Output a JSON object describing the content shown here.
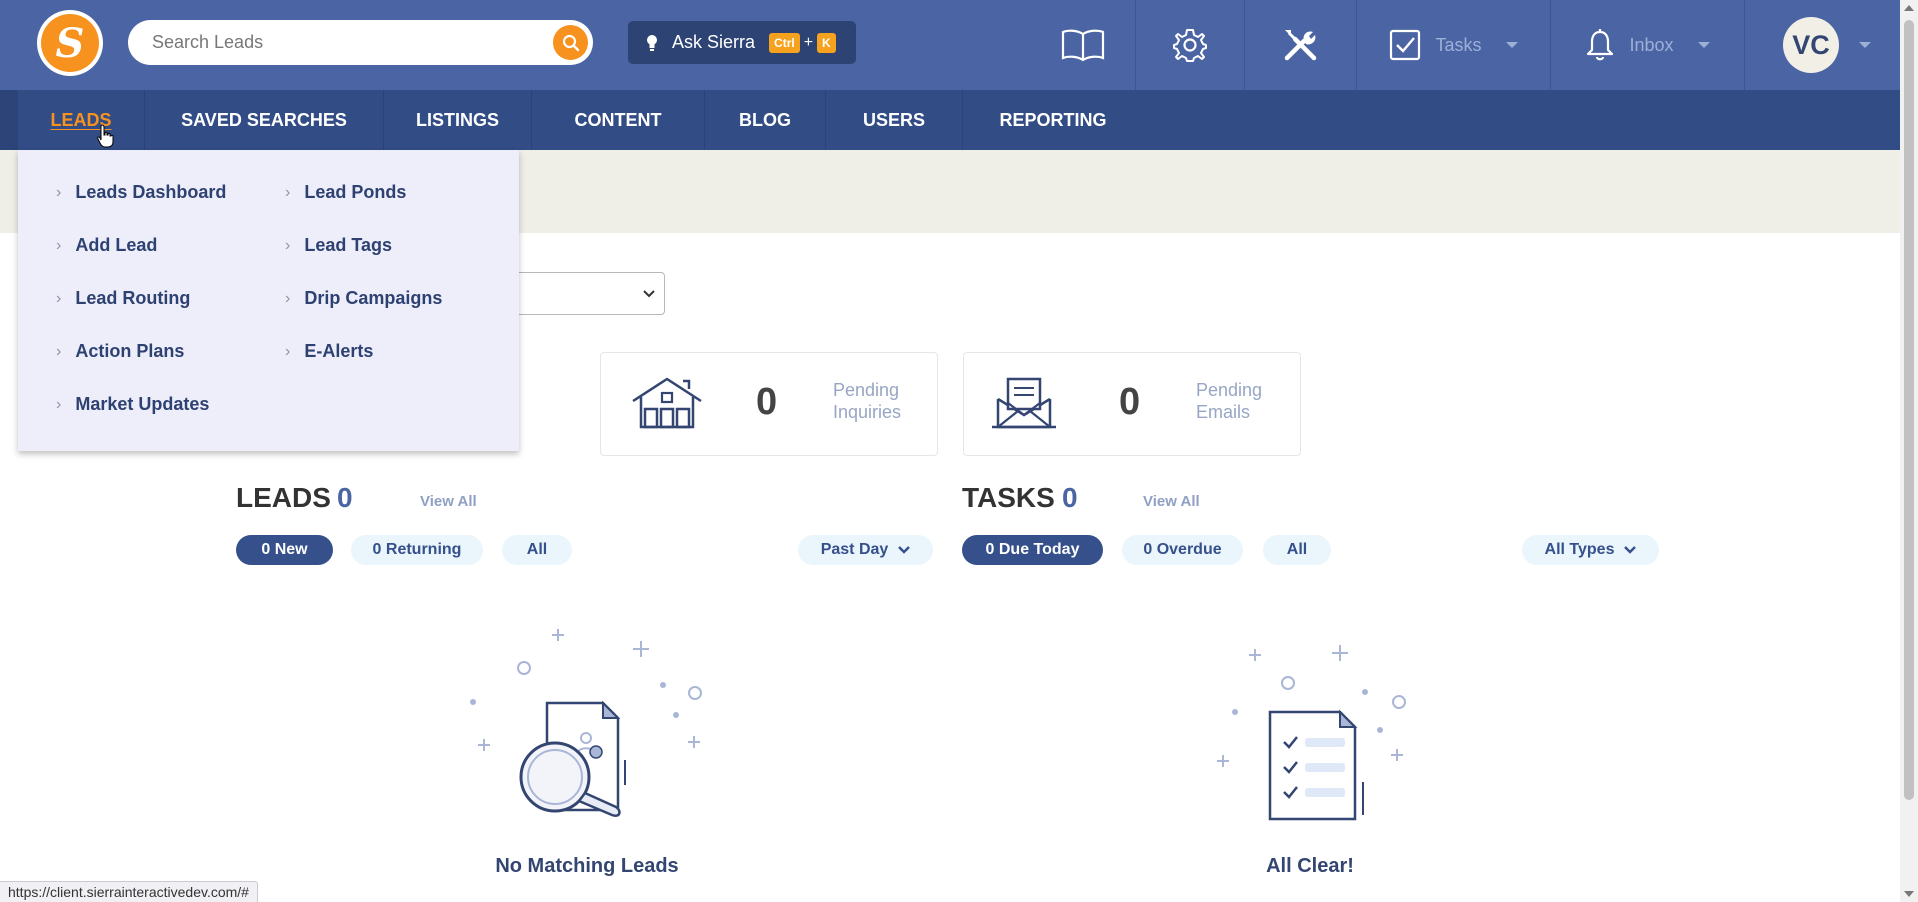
{
  "header": {
    "logo_letter": "S",
    "search_placeholder": "Search Leads",
    "ask_label": "Ask Sierra",
    "ask_kbd_ctrl": "Ctrl",
    "ask_kbd_plus": "+",
    "ask_kbd_key": "K",
    "tasks_label": "Tasks",
    "inbox_label": "Inbox",
    "avatar_initials": "VC",
    "icons": [
      "book-icon",
      "gear-icon",
      "tools-icon",
      "checkbox-icon",
      "bell-icon"
    ]
  },
  "nav": {
    "items": [
      "LEADS",
      "SAVED SEARCHES",
      "LISTINGS",
      "CONTENT",
      "BLOG",
      "USERS",
      "REPORTING"
    ],
    "active": "LEADS"
  },
  "leads_menu": {
    "col1": [
      "Leads Dashboard",
      "Add Lead",
      "Lead Routing",
      "Action Plans",
      "Market Updates"
    ],
    "col2": [
      "Lead Ponds",
      "Lead Tags",
      "Drip Campaigns",
      "E-Alerts"
    ]
  },
  "stats": {
    "inquiries": {
      "count": "0",
      "label1": "Pending",
      "label2": "Inquiries"
    },
    "emails": {
      "count": "0",
      "label1": "Pending",
      "label2": "Emails"
    }
  },
  "leads": {
    "title": "LEADS",
    "count": "0",
    "view_all": "View All",
    "filters": [
      "0 New",
      "0 Returning",
      "All"
    ],
    "period": "Past Day",
    "empty": "No Matching Leads"
  },
  "tasks": {
    "title": "TASKS",
    "count": "0",
    "view_all": "View All",
    "filters": [
      "0 Due Today",
      "0 Overdue",
      "All"
    ],
    "types": "All Types",
    "empty": "All Clear!"
  },
  "status_url": "https://client.sierrainteractivedev.com/#",
  "colors": {
    "header": "#4b64a3",
    "nav": "#324c86",
    "accent": "#f7921e",
    "dropdown_bg": "#eeeefa"
  }
}
